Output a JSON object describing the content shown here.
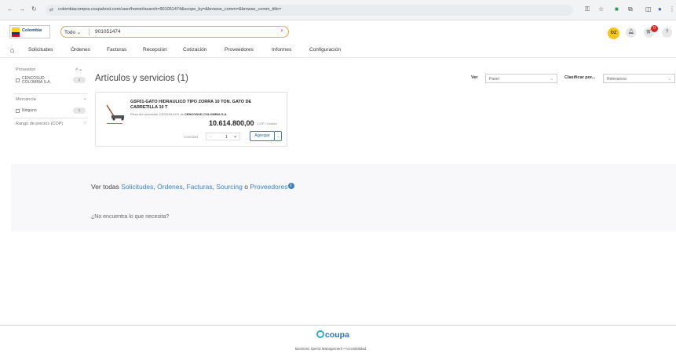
{
  "browser": {
    "url": "colombiacompra.coupahost.com/user/home#search=901051474&scope_by=&browse_comm=&browse_comm_title="
  },
  "header": {
    "logo_text": "Colombia",
    "search_scope": "Todo",
    "search_value": "901051474",
    "avatar_initials": "OZ",
    "cart_count": "0",
    "help_label": "?"
  },
  "menu": {
    "items": [
      "Solicitudes",
      "Órdenes",
      "Facturas",
      "Recepción",
      "Cotización",
      "Proveedores",
      "Informes",
      "Configuración"
    ]
  },
  "sidebar": {
    "proveedor_label": "Proveedor",
    "proveedor_item": "CENCOSUD COLOMBIA S.A.",
    "proveedor_count": "1",
    "mercancia_label": "Mercancía",
    "mercancia_item": "Ninguno",
    "mercancia_count": "1",
    "rango_label": "Rango de precios (COP)"
  },
  "main": {
    "title": "Artículos y servicios (1)",
    "ver_label": "Ver",
    "ver_value": "Panel",
    "clasificar_label": "Clasificar por...",
    "clasificar_value": "Relevancia"
  },
  "item": {
    "title": "GSF01-GATO HIDRAULICO TIPO ZORRA 10 TON. GATO DE CARRETILLA 10 T",
    "supplier_prefix": "Pieza del proveedor CE901051474 de",
    "supplier_name": "CENCOSUD COLOMBIA S.A.",
    "price": "10.614.800,00",
    "unit": "COP / Unidad",
    "qty_label": "Cantidad",
    "qty_minus": "−",
    "qty_value": "1",
    "qty_plus": "+",
    "add_label": "Agregar"
  },
  "band": {
    "prefix": "Ver todas",
    "links": [
      "Solicitudes",
      "Órdenes",
      "Facturas",
      "Sourcing",
      "Proveedores"
    ],
    "sep1": ",",
    "sep2": ",",
    "sep3": ",",
    "or": "o",
    "info": "i",
    "not_found": "¿No encuentra lo que necesita?"
  },
  "footer": {
    "brand": "coupa",
    "link1": "Business Spend Management",
    "dot": "•",
    "link2": "Accesibilidad"
  },
  "colors": {
    "accent": "#3b82c4",
    "search_border": "#f0a040",
    "avatar": "#f5c518",
    "badge": "#dd2222"
  }
}
